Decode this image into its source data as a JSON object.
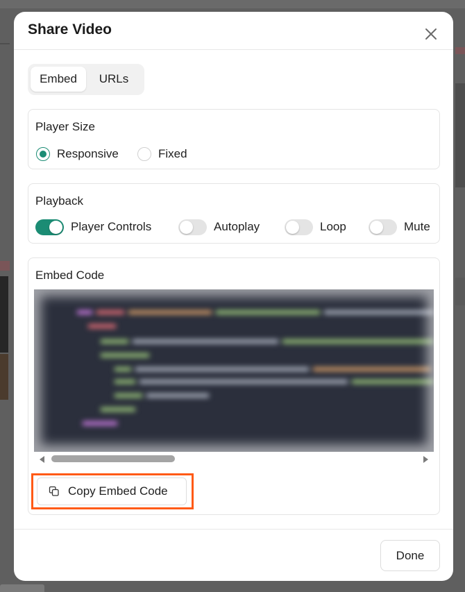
{
  "modal": {
    "title": "Share Video"
  },
  "tabs": [
    {
      "label": "Embed",
      "active": true
    },
    {
      "label": "URLs",
      "active": false
    }
  ],
  "player_size": {
    "title": "Player Size",
    "options": [
      {
        "label": "Responsive",
        "selected": true
      },
      {
        "label": "Fixed",
        "selected": false
      }
    ]
  },
  "playback": {
    "title": "Playback",
    "toggles": [
      {
        "label": "Player Controls",
        "on": true
      },
      {
        "label": "Autoplay",
        "on": false
      },
      {
        "label": "Loop",
        "on": false
      },
      {
        "label": "Mute",
        "on": false
      }
    ]
  },
  "embed": {
    "title": "Embed Code",
    "copy_label": "Copy Embed Code"
  },
  "footer": {
    "done_label": "Done"
  },
  "colors": {
    "accent": "#1b8c74",
    "highlight": "#ff5a16",
    "code_background": "#2b2f3c"
  }
}
